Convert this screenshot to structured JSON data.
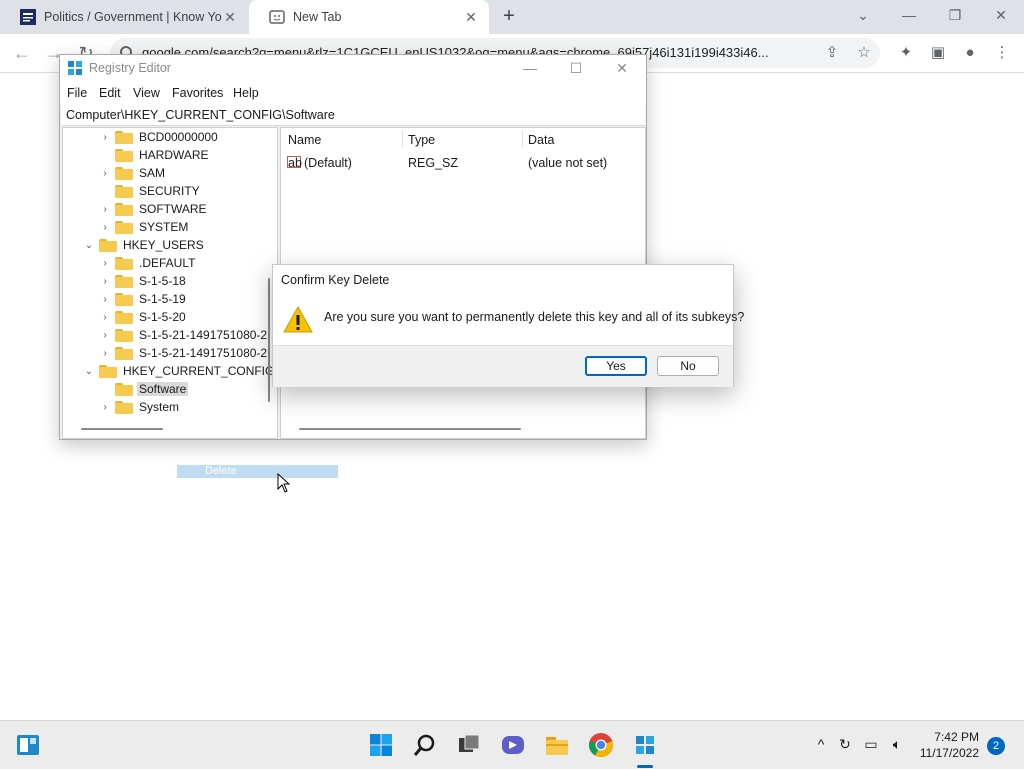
{
  "browser": {
    "tabs": [
      {
        "title": "Politics / Government | Know Yo",
        "close": "✕"
      },
      {
        "title": "New Tab",
        "close": "✕"
      }
    ],
    "new_tab": "+",
    "url": "google.com/search?q=menu&rlz=1C1GCEU_enUS1032&oq=menu&aqs=chrome..69i57j46i131i199i433i46..."
  },
  "regedit": {
    "title": "Registry Editor",
    "menu": [
      "File",
      "Edit",
      "View",
      "Favorites",
      "Help"
    ],
    "address": "Computer\\HKEY_CURRENT_CONFIG\\Software",
    "tree": [
      {
        "label": "BCD00000000",
        "expander": "›"
      },
      {
        "label": "HARDWARE",
        "expander": ""
      },
      {
        "label": "SAM",
        "expander": "›"
      },
      {
        "label": "SECURITY",
        "expander": ""
      },
      {
        "label": "SOFTWARE",
        "expander": "›"
      },
      {
        "label": "SYSTEM",
        "expander": "›"
      },
      {
        "label": "HKEY_USERS",
        "expander": "⌄"
      },
      {
        "label": ".DEFAULT",
        "expander": "›"
      },
      {
        "label": "S-1-5-18",
        "expander": "›"
      },
      {
        "label": "S-1-5-19",
        "expander": "›"
      },
      {
        "label": "S-1-5-20",
        "expander": "›"
      },
      {
        "label": "S-1-5-21-1491751080-2",
        "expander": "›"
      },
      {
        "label": "S-1-5-21-1491751080-2",
        "expander": "›"
      },
      {
        "label": "HKEY_CURRENT_CONFIG",
        "expander": "⌄"
      },
      {
        "label": "Software",
        "expander": "",
        "selected": true
      },
      {
        "label": "System",
        "expander": "›"
      }
    ],
    "columns": [
      "Name",
      "Type",
      "Data"
    ],
    "values": [
      {
        "name": "(Default)",
        "type": "REG_SZ",
        "data": "(value not set)"
      }
    ]
  },
  "dialog": {
    "title": "Confirm Key Delete",
    "message": "Are you sure you want to permanently delete this key and all of its subkeys?",
    "yes": "Yes",
    "no": "No"
  },
  "drag_ghost": {
    "label": "Delete"
  },
  "taskbar": {
    "time": "7:42 PM",
    "date": "11/17/2022",
    "notifications": "2"
  },
  "colors": {
    "accent": "#0067c0",
    "folder": "#f6c94f",
    "warning": "#f7c200"
  }
}
